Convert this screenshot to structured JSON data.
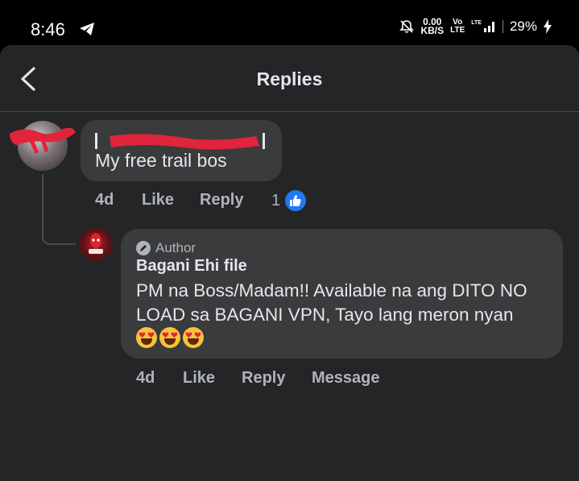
{
  "status_bar": {
    "time": "8:46",
    "net_speed_value": "0.00",
    "net_speed_unit": "KB/S",
    "volte_top": "Vo",
    "volte_bottom": "LTE",
    "lte_label": "LTE",
    "battery": "29%",
    "icons": [
      "telegram-icon",
      "mute-icon",
      "signal-icon",
      "charging-icon"
    ]
  },
  "header": {
    "title": "Replies",
    "back_icon": "chevron-left-icon"
  },
  "comment": {
    "text": "My free trail bos",
    "time": "4d",
    "like_label": "Like",
    "reply_label": "Reply",
    "reaction_count": "1",
    "reaction_icon": "thumbs-up-icon"
  },
  "reply": {
    "author_badge": "Author",
    "name": "Bagani Ehi file",
    "text": "PM na Boss/Madam!! Available na ang DITO NO LOAD sa BAGANI VPN, Tayo lang meron nyan",
    "emoji_icon": "heart-eyes-emoji",
    "emoji_count": 3,
    "time": "4d",
    "like_label": "Like",
    "reply_label": "Reply",
    "message_label": "Message"
  },
  "colors": {
    "background": "#242526",
    "bubble": "#3a3b3c",
    "text": "#e4e6eb",
    "muted": "#b0b3b8",
    "like_blue": "#2078f4",
    "redaction": "#e0243c"
  }
}
